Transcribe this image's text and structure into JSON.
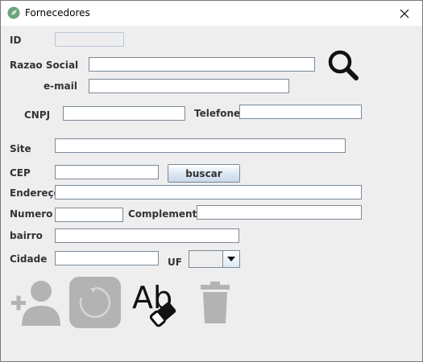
{
  "window": {
    "title": "Fornecedores",
    "app_icon": "leaf-icon",
    "close_icon": "close-icon"
  },
  "form": {
    "id_label": "ID",
    "id_value": "",
    "razao_social_label": "Razao Social",
    "razao_social_value": "",
    "email_label": "e-mail",
    "email_value": "",
    "cnpj_label": "CNPJ",
    "cnpj_value": "",
    "telefone_label": "Telefone",
    "telefone_value": "",
    "site_label": "Site",
    "site_value": "",
    "cep_label": "CEP",
    "cep_value": "",
    "buscar_label": "buscar",
    "endereco_label": "Endereço",
    "endereco_value": "",
    "numero_label": "Numero",
    "numero_value": "",
    "complemento_label": "Complemento",
    "complemento_value": "",
    "bairro_label": "bairro",
    "bairro_value": "",
    "cidade_label": "Cidade",
    "cidade_value": "",
    "uf_label": "UF",
    "uf_value": ""
  },
  "actions": {
    "search_icon": "search-icon",
    "add_user_icon": "add-user-icon",
    "refresh_icon": "refresh-icon",
    "clear_icon": "eraser-icon",
    "delete_icon": "trash-icon"
  },
  "colors": {
    "window_bg": "#eeeeee",
    "titlebar_bg": "#ffffff",
    "icon_gray": "#b3b3b3",
    "icon_dark": "#111111"
  }
}
